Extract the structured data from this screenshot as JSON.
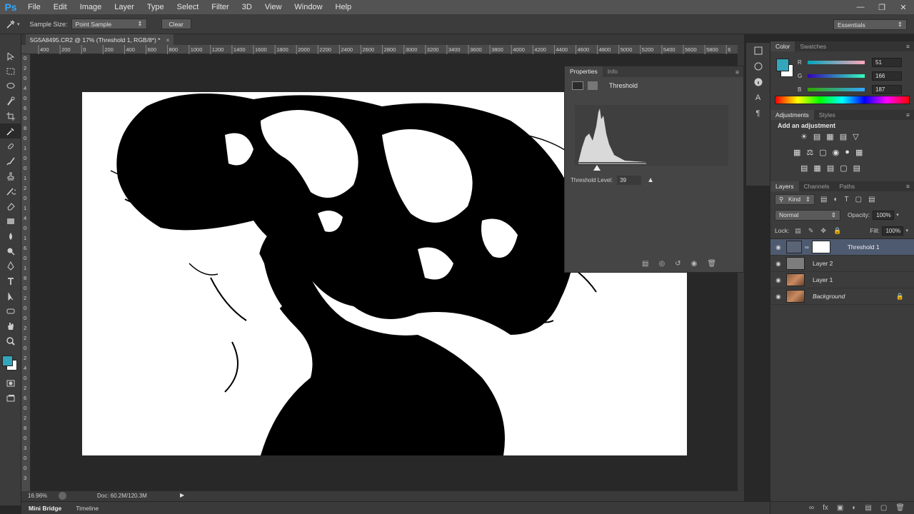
{
  "app": {
    "logo": "Ps"
  },
  "menu": [
    "File",
    "Edit",
    "Image",
    "Layer",
    "Type",
    "Select",
    "Filter",
    "3D",
    "View",
    "Window",
    "Help"
  ],
  "options": {
    "sample_size_label": "Sample Size:",
    "sample_size_value": "Point Sample",
    "clear_label": "Clear",
    "workspace": "Essentials"
  },
  "document": {
    "tab_title": "5G5A8495.CR2 @ 17% (Threshold 1, RGB/8*) *",
    "ruler_labels": [
      "400",
      "200",
      "0",
      "200",
      "400",
      "600",
      "800",
      "1000",
      "1200",
      "1400",
      "1600",
      "1800",
      "2000",
      "2200",
      "2400",
      "2600",
      "2800",
      "3000",
      "3200",
      "3400",
      "3600",
      "3800",
      "4000",
      "4200",
      "4400",
      "4600",
      "4800",
      "5000",
      "5200",
      "5400",
      "5600",
      "5800",
      "6"
    ],
    "vruler_labels": [
      "0",
      "2",
      "0",
      "4",
      "0",
      "6",
      "0",
      "8",
      "0",
      "1",
      "0",
      "0",
      "1",
      "2",
      "0",
      "1",
      "4",
      "0",
      "1",
      "6",
      "0",
      "1",
      "8",
      "0",
      "2",
      "0",
      "0",
      "2",
      "2",
      "0",
      "2",
      "4",
      "0",
      "2",
      "6",
      "0",
      "2",
      "8",
      "0",
      "3",
      "0",
      "0",
      "3"
    ],
    "zoom": "16.96%",
    "doc_size": "Doc: 60.2M/120.3M"
  },
  "bottom_tabs": [
    "Mini Bridge",
    "Timeline"
  ],
  "properties": {
    "tabs": [
      "Properties",
      "Info"
    ],
    "title": "Threshold",
    "threshold_label": "Threshold Level:",
    "threshold_value": "39"
  },
  "color_panel": {
    "tabs": [
      "Color",
      "Swatches"
    ],
    "foreground": "#33a6bb",
    "background": "#ffffff",
    "channels": [
      {
        "label": "R",
        "value": "51"
      },
      {
        "label": "G",
        "value": "166"
      },
      {
        "label": "B",
        "value": "187"
      }
    ]
  },
  "adjustments": {
    "tabs": [
      "Adjustments",
      "Styles"
    ],
    "heading": "Add an adjustment"
  },
  "layers_panel": {
    "tabs": [
      "Layers",
      "Channels",
      "Paths"
    ],
    "filter": "Kind",
    "blend_mode": "Normal",
    "opacity_label": "Opacity:",
    "opacity": "100%",
    "lock_label": "Lock:",
    "fill_label": "Fill:",
    "fill": "100%",
    "layers": [
      {
        "name": "Threshold 1",
        "selected": true
      },
      {
        "name": "Layer 2",
        "selected": false
      },
      {
        "name": "Layer 1",
        "selected": false
      },
      {
        "name": "Background",
        "selected": false
      }
    ]
  },
  "colors": {
    "accent": "#33a6bb",
    "selected_layer": "#4d5a6f"
  }
}
